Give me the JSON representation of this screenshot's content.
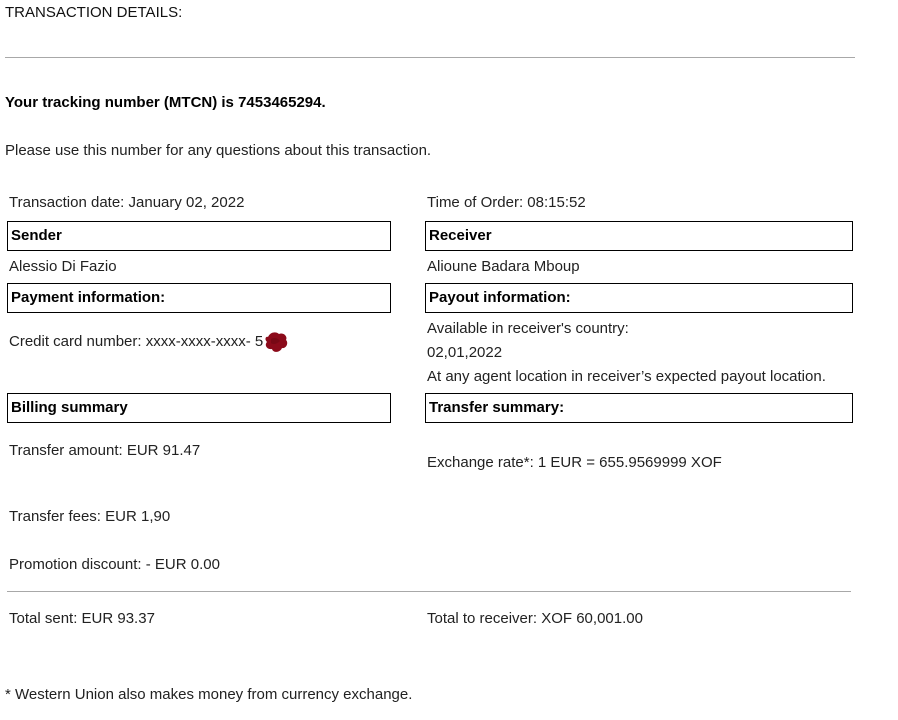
{
  "header": {
    "title": "TRANSACTION DETAILS:"
  },
  "tracking": {
    "text": "Your tracking number (MTCN) is 7453465294."
  },
  "notice": "Please use this number for any questions about this transaction.",
  "transaction": {
    "date_text": "Transaction date: January 02, 2022",
    "time_text": "Time of Order: 08:15:52"
  },
  "sender": {
    "heading": "Sender",
    "name": "Alessio Di Fazio"
  },
  "receiver": {
    "heading": "Receiver",
    "name": "Alioune Badara Mboup"
  },
  "payment": {
    "heading": "Payment information:",
    "card_text": "Credit card number: xxxx-xxxx-xxxx- 5",
    "redaction_color": "#8b0a1a"
  },
  "payout": {
    "heading": "Payout information:",
    "line1": "Available in receiver's country:",
    "line2": "02,01,2022",
    "line3": "At any agent location in receiver’s expected payout location."
  },
  "billing": {
    "heading": "Billing summary",
    "transfer_amount": "Transfer amount: EUR 91.47",
    "transfer_fees": "Transfer fees: EUR 1,90",
    "promotion_discount": "Promotion discount: - EUR 0.00",
    "total_sent": "Total sent: EUR 93.37"
  },
  "transfer_summary": {
    "heading": "Transfer summary:",
    "exchange_rate": "Exchange rate*: 1 EUR = 655.9569999 XOF",
    "total_to_receiver": "Total to receiver: XOF 60,001.00"
  },
  "footnote": "* Western Union also makes money from currency exchange."
}
